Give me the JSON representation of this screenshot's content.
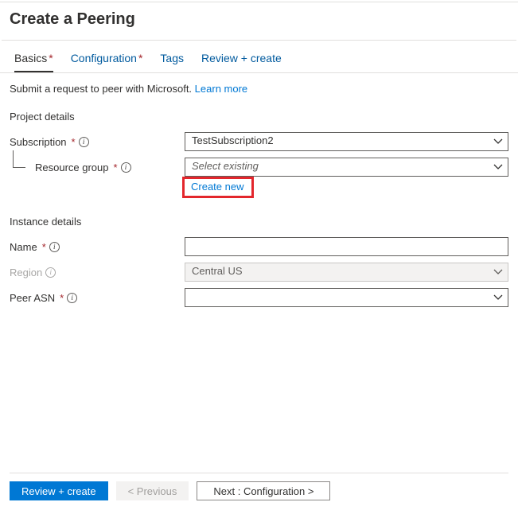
{
  "title": "Create a Peering",
  "tabs": [
    {
      "label": "Basics",
      "active": true,
      "required": true
    },
    {
      "label": "Configuration",
      "active": false,
      "required": true
    },
    {
      "label": "Tags",
      "active": false,
      "required": false
    },
    {
      "label": "Review + create",
      "active": false,
      "required": false
    }
  ],
  "desc": {
    "text": "Submit a request to peer with Microsoft.",
    "learn": "Learn more"
  },
  "project": {
    "heading": "Project details",
    "subscription": {
      "label": "Subscription",
      "value": "TestSubscription2"
    },
    "resourceGroup": {
      "label": "Resource group",
      "placeholder": "Select existing",
      "createNew": "Create new"
    }
  },
  "instance": {
    "heading": "Instance details",
    "name": {
      "label": "Name",
      "value": ""
    },
    "region": {
      "label": "Region",
      "value": "Central US"
    },
    "peerAsn": {
      "label": "Peer ASN",
      "value": ""
    }
  },
  "footer": {
    "review": "Review + create",
    "previous": "< Previous",
    "next": "Next : Configuration >"
  },
  "asterisk": "*"
}
